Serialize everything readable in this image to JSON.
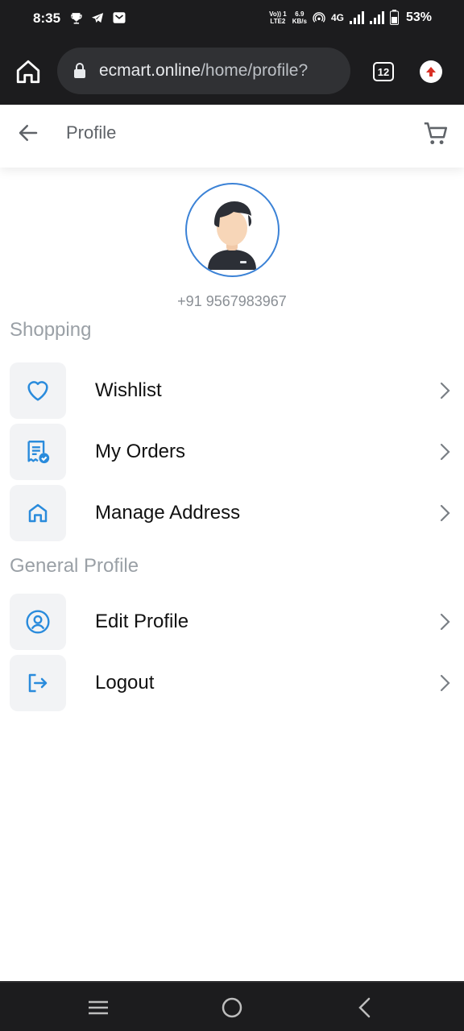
{
  "status_bar": {
    "time": "8:35",
    "network_top": "Vo)) 1",
    "network_bottom": "LTE2",
    "speed_top": "6.9",
    "speed_bottom": "KB/s",
    "network_type": "4G",
    "battery": "53%",
    "icons": [
      "trophy-icon",
      "telegram-icon",
      "mail-icon",
      "hotspot-icon",
      "signal-icon",
      "battery-icon"
    ]
  },
  "browser": {
    "url_domain": "ecmart.online",
    "url_path": "/home/profile?",
    "tab_count": "12",
    "accent_update": "#d93025"
  },
  "header": {
    "title": "Profile"
  },
  "profile": {
    "phone": "+91 9567983967"
  },
  "sections": {
    "shopping": "Shopping",
    "general": "General Profile"
  },
  "menu": {
    "wishlist": "Wishlist",
    "my_orders": "My Orders",
    "manage_address": "Manage Address",
    "edit_profile": "Edit Profile",
    "logout": "Logout"
  },
  "colors": {
    "accent": "#2a8bdc",
    "avatar_ring": "#3b82d6",
    "muted": "#9aa0a6"
  }
}
